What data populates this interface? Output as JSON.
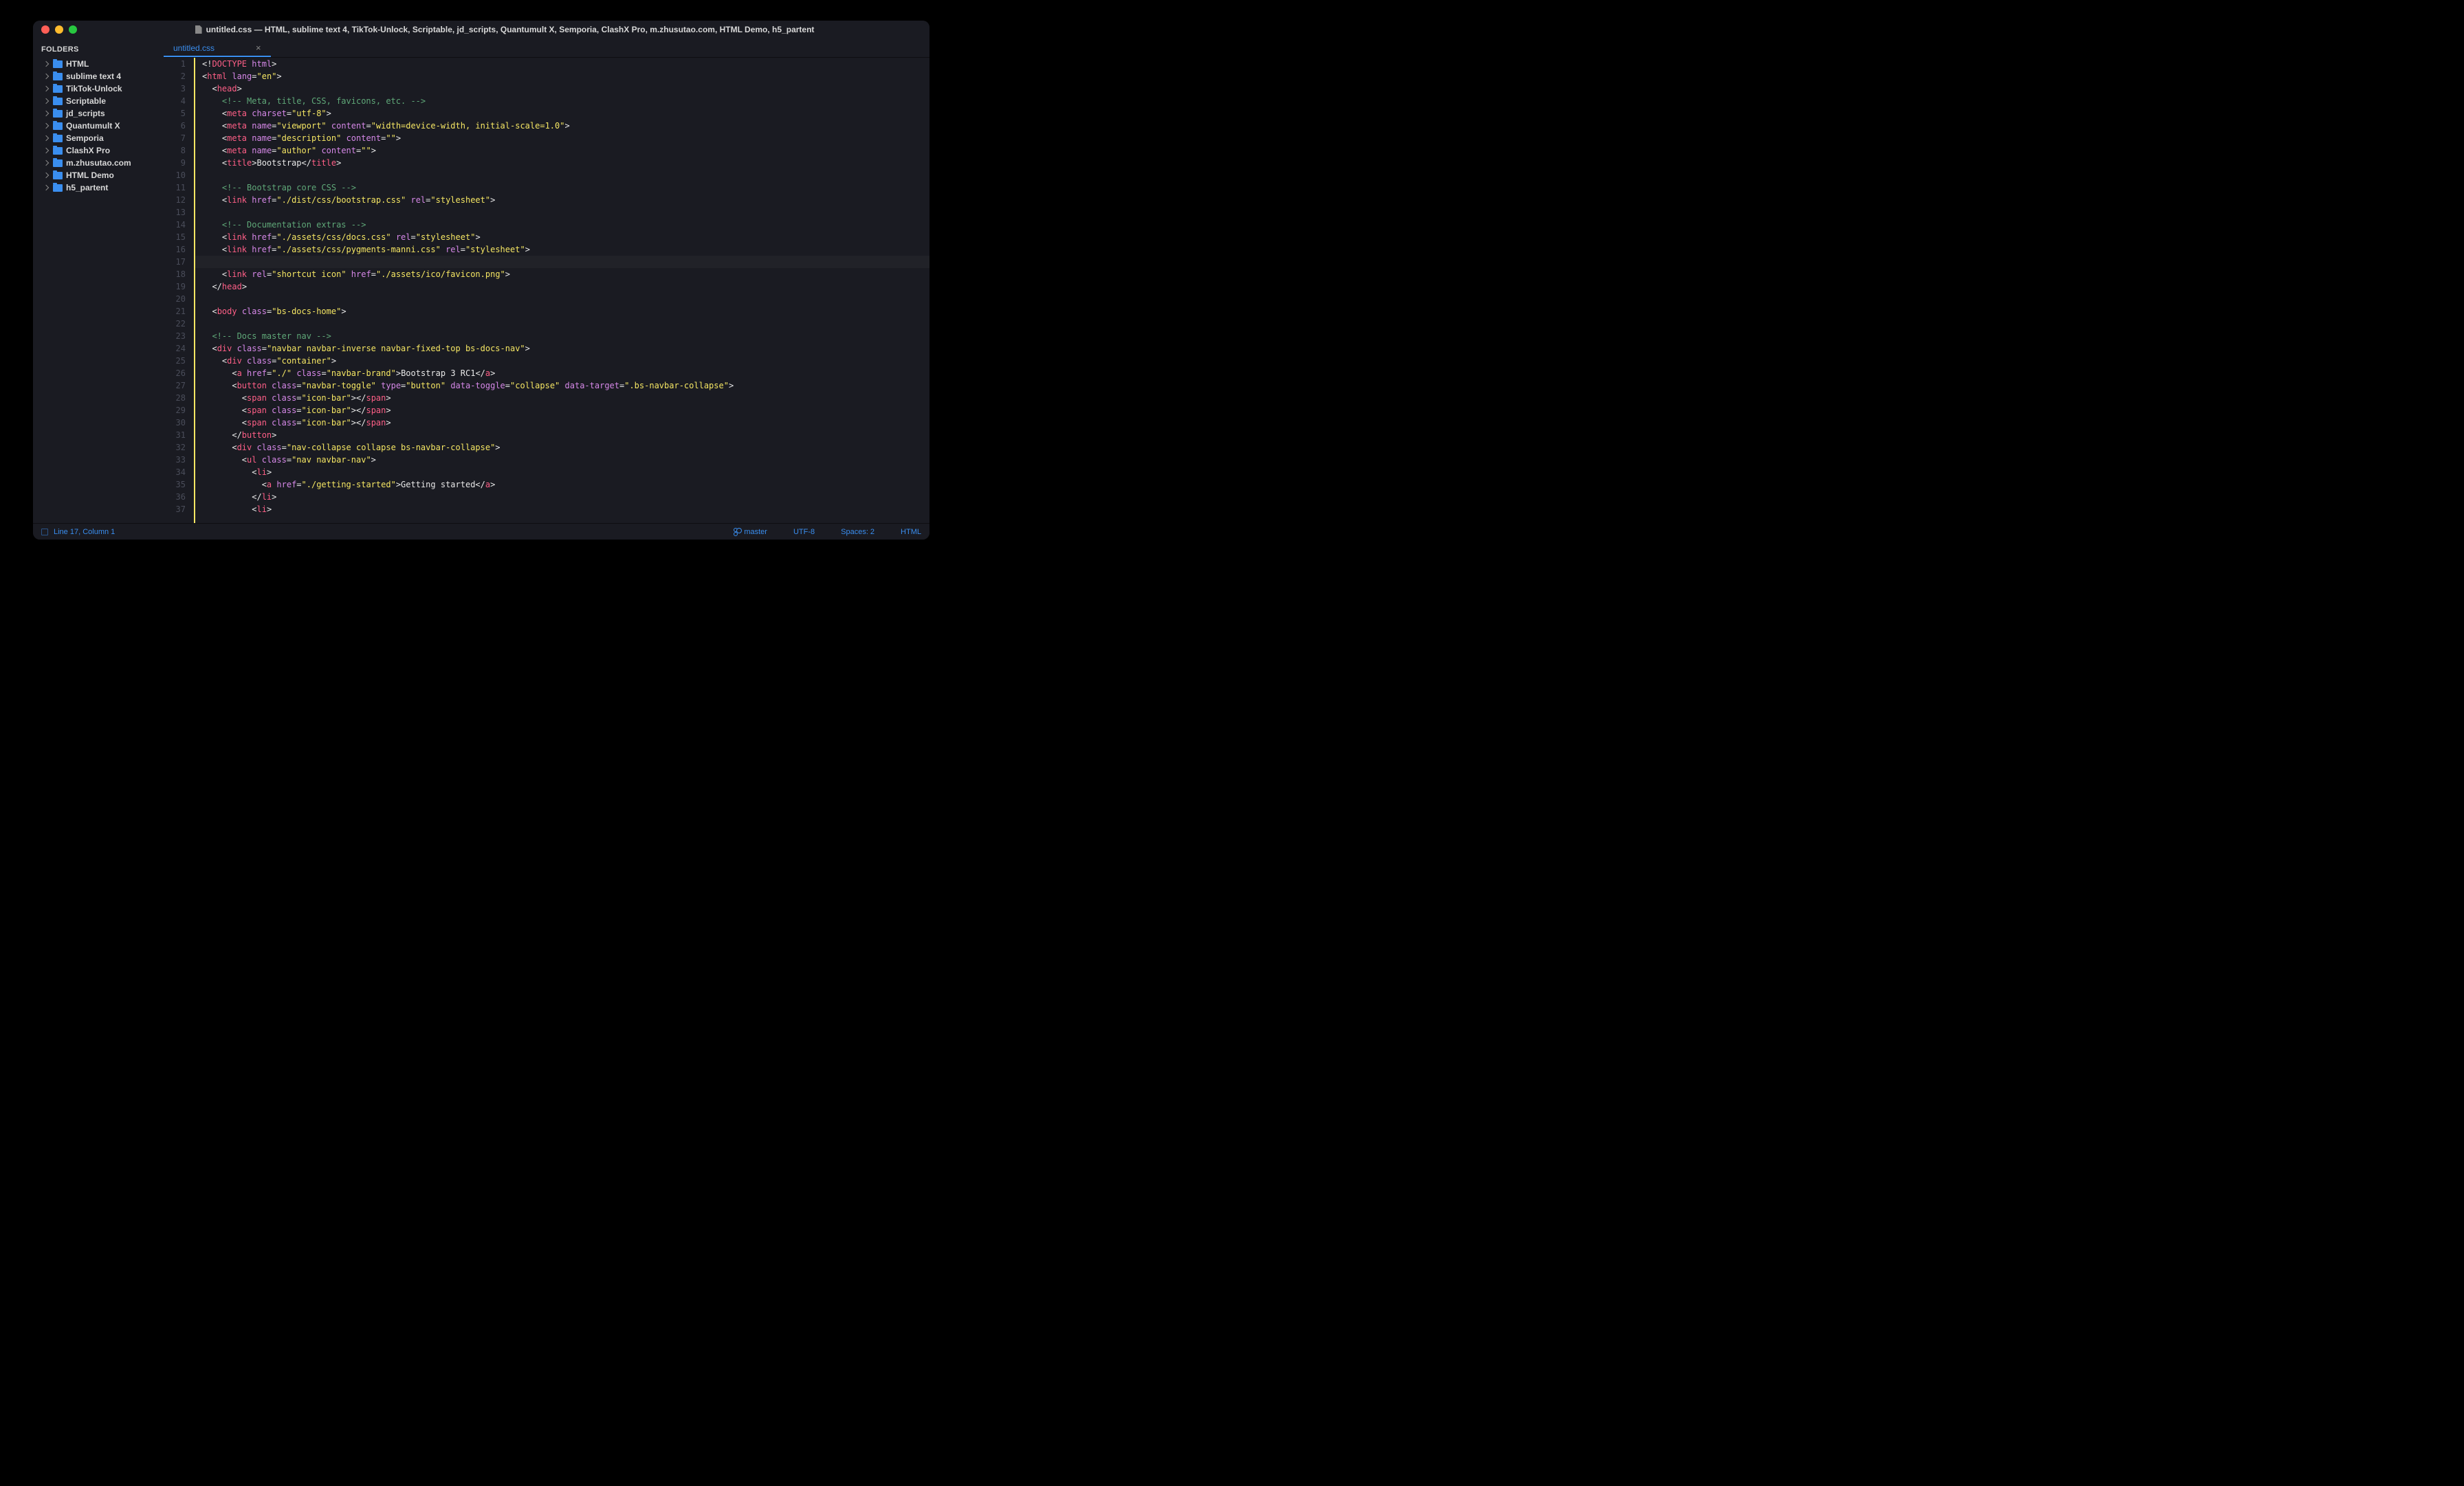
{
  "titlebar": {
    "title": "untitled.css — HTML, sublime text 4, TikTok-Unlock, Scriptable, jd_scripts, Quantumult X, Semporia, ClashX Pro, m.zhusutao.com, HTML Demo, h5_partent"
  },
  "sidebar": {
    "header": "FOLDERS",
    "folders": [
      "HTML",
      "sublime text 4",
      "TikTok-Unlock",
      "Scriptable",
      "jd_scripts",
      "Quantumult X",
      "Semporia",
      "ClashX Pro",
      "m.zhusutao.com",
      "HTML Demo",
      "h5_partent"
    ]
  },
  "tabs": {
    "active": "untitled.css"
  },
  "code": {
    "lines": [
      {
        "n": 1,
        "t": [
          [
            "<!",
            "punc"
          ],
          [
            "DOCTYPE",
            "doctype"
          ],
          [
            " ",
            "punc"
          ],
          [
            "html",
            "doctype-val"
          ],
          [
            ">",
            "punc"
          ]
        ]
      },
      {
        "n": 2,
        "t": [
          [
            "<",
            "punc"
          ],
          [
            "html",
            "tag"
          ],
          [
            " ",
            "punc"
          ],
          [
            "lang",
            "attr"
          ],
          [
            "=",
            "punc"
          ],
          [
            "\"en\"",
            "string"
          ],
          [
            ">",
            "punc"
          ]
        ]
      },
      {
        "n": 3,
        "t": [
          [
            "  <",
            "punc"
          ],
          [
            "head",
            "tag"
          ],
          [
            ">",
            "punc"
          ]
        ]
      },
      {
        "n": 4,
        "t": [
          [
            "    ",
            "punc"
          ],
          [
            "<!-- Meta, title, CSS, favicons, etc. -->",
            "comment"
          ]
        ]
      },
      {
        "n": 5,
        "t": [
          [
            "    <",
            "punc"
          ],
          [
            "meta",
            "tag"
          ],
          [
            " ",
            "punc"
          ],
          [
            "charset",
            "attr"
          ],
          [
            "=",
            "punc"
          ],
          [
            "\"utf-8\"",
            "string"
          ],
          [
            ">",
            "punc"
          ]
        ]
      },
      {
        "n": 6,
        "t": [
          [
            "    <",
            "punc"
          ],
          [
            "meta",
            "tag"
          ],
          [
            " ",
            "punc"
          ],
          [
            "name",
            "attr"
          ],
          [
            "=",
            "punc"
          ],
          [
            "\"viewport\"",
            "string"
          ],
          [
            " ",
            "punc"
          ],
          [
            "content",
            "attr"
          ],
          [
            "=",
            "punc"
          ],
          [
            "\"width=device-width, initial-scale=1.0\"",
            "string"
          ],
          [
            ">",
            "punc"
          ]
        ]
      },
      {
        "n": 7,
        "t": [
          [
            "    <",
            "punc"
          ],
          [
            "meta",
            "tag"
          ],
          [
            " ",
            "punc"
          ],
          [
            "name",
            "attr"
          ],
          [
            "=",
            "punc"
          ],
          [
            "\"description\"",
            "string"
          ],
          [
            " ",
            "punc"
          ],
          [
            "content",
            "attr"
          ],
          [
            "=",
            "punc"
          ],
          [
            "\"\"",
            "string"
          ],
          [
            ">",
            "punc"
          ]
        ]
      },
      {
        "n": 8,
        "t": [
          [
            "    <",
            "punc"
          ],
          [
            "meta",
            "tag"
          ],
          [
            " ",
            "punc"
          ],
          [
            "name",
            "attr"
          ],
          [
            "=",
            "punc"
          ],
          [
            "\"author\"",
            "string"
          ],
          [
            " ",
            "punc"
          ],
          [
            "content",
            "attr"
          ],
          [
            "=",
            "punc"
          ],
          [
            "\"\"",
            "string"
          ],
          [
            ">",
            "punc"
          ]
        ]
      },
      {
        "n": 9,
        "t": [
          [
            "    <",
            "punc"
          ],
          [
            "title",
            "tag"
          ],
          [
            ">",
            "punc"
          ],
          [
            "Bootstrap",
            "text"
          ],
          [
            "</",
            "punc"
          ],
          [
            "title",
            "tag"
          ],
          [
            ">",
            "punc"
          ]
        ]
      },
      {
        "n": 10,
        "t": []
      },
      {
        "n": 11,
        "t": [
          [
            "    ",
            "punc"
          ],
          [
            "<!-- Bootstrap core CSS -->",
            "comment"
          ]
        ]
      },
      {
        "n": 12,
        "t": [
          [
            "    <",
            "punc"
          ],
          [
            "link",
            "tag"
          ],
          [
            " ",
            "punc"
          ],
          [
            "href",
            "attr"
          ],
          [
            "=",
            "punc"
          ],
          [
            "\"./dist/css/bootstrap.css\"",
            "string"
          ],
          [
            " ",
            "punc"
          ],
          [
            "rel",
            "attr"
          ],
          [
            "=",
            "punc"
          ],
          [
            "\"stylesheet\"",
            "string"
          ],
          [
            ">",
            "punc"
          ]
        ]
      },
      {
        "n": 13,
        "t": []
      },
      {
        "n": 14,
        "t": [
          [
            "    ",
            "punc"
          ],
          [
            "<!-- Documentation extras -->",
            "comment"
          ]
        ]
      },
      {
        "n": 15,
        "t": [
          [
            "    <",
            "punc"
          ],
          [
            "link",
            "tag"
          ],
          [
            " ",
            "punc"
          ],
          [
            "href",
            "attr"
          ],
          [
            "=",
            "punc"
          ],
          [
            "\"./assets/css/docs.css\"",
            "string"
          ],
          [
            " ",
            "punc"
          ],
          [
            "rel",
            "attr"
          ],
          [
            "=",
            "punc"
          ],
          [
            "\"stylesheet\"",
            "string"
          ],
          [
            ">",
            "punc"
          ]
        ]
      },
      {
        "n": 16,
        "t": [
          [
            "    <",
            "punc"
          ],
          [
            "link",
            "tag"
          ],
          [
            " ",
            "punc"
          ],
          [
            "href",
            "attr"
          ],
          [
            "=",
            "punc"
          ],
          [
            "\"./assets/css/pygments-manni.css\"",
            "string"
          ],
          [
            " ",
            "punc"
          ],
          [
            "rel",
            "attr"
          ],
          [
            "=",
            "punc"
          ],
          [
            "\"stylesheet\"",
            "string"
          ],
          [
            ">",
            "punc"
          ]
        ]
      },
      {
        "n": 17,
        "t": [],
        "hl": true
      },
      {
        "n": 18,
        "t": [
          [
            "    <",
            "punc"
          ],
          [
            "link",
            "tag"
          ],
          [
            " ",
            "punc"
          ],
          [
            "rel",
            "attr"
          ],
          [
            "=",
            "punc"
          ],
          [
            "\"shortcut icon\"",
            "string"
          ],
          [
            " ",
            "punc"
          ],
          [
            "href",
            "attr"
          ],
          [
            "=",
            "punc"
          ],
          [
            "\"./assets/ico/favicon.png\"",
            "string"
          ],
          [
            ">",
            "punc"
          ]
        ]
      },
      {
        "n": 19,
        "t": [
          [
            "  </",
            "punc"
          ],
          [
            "head",
            "tag"
          ],
          [
            ">",
            "punc"
          ]
        ]
      },
      {
        "n": 20,
        "t": []
      },
      {
        "n": 21,
        "t": [
          [
            "  <",
            "punc"
          ],
          [
            "body",
            "tag"
          ],
          [
            " ",
            "punc"
          ],
          [
            "class",
            "attr"
          ],
          [
            "=",
            "punc"
          ],
          [
            "\"bs-docs-home\"",
            "string"
          ],
          [
            ">",
            "punc"
          ]
        ]
      },
      {
        "n": 22,
        "t": []
      },
      {
        "n": 23,
        "t": [
          [
            "  ",
            "punc"
          ],
          [
            "<!-- Docs master nav -->",
            "comment"
          ]
        ]
      },
      {
        "n": 24,
        "t": [
          [
            "  <",
            "punc"
          ],
          [
            "div",
            "tag"
          ],
          [
            " ",
            "punc"
          ],
          [
            "class",
            "attr"
          ],
          [
            "=",
            "punc"
          ],
          [
            "\"navbar navbar-inverse navbar-fixed-top bs-docs-nav\"",
            "string"
          ],
          [
            ">",
            "punc"
          ]
        ]
      },
      {
        "n": 25,
        "t": [
          [
            "    <",
            "punc"
          ],
          [
            "div",
            "tag"
          ],
          [
            " ",
            "punc"
          ],
          [
            "class",
            "attr"
          ],
          [
            "=",
            "punc"
          ],
          [
            "\"container\"",
            "string"
          ],
          [
            ">",
            "punc"
          ]
        ]
      },
      {
        "n": 26,
        "t": [
          [
            "      <",
            "punc"
          ],
          [
            "a",
            "tag"
          ],
          [
            " ",
            "punc"
          ],
          [
            "href",
            "attr"
          ],
          [
            "=",
            "punc"
          ],
          [
            "\"./\"",
            "string"
          ],
          [
            " ",
            "punc"
          ],
          [
            "class",
            "attr"
          ],
          [
            "=",
            "punc"
          ],
          [
            "\"navbar-brand\"",
            "string"
          ],
          [
            ">",
            "punc"
          ],
          [
            "Bootstrap 3 RC1",
            "text"
          ],
          [
            "</",
            "punc"
          ],
          [
            "a",
            "tag"
          ],
          [
            ">",
            "punc"
          ]
        ]
      },
      {
        "n": 27,
        "t": [
          [
            "      <",
            "punc"
          ],
          [
            "button",
            "tag"
          ],
          [
            " ",
            "punc"
          ],
          [
            "class",
            "attr"
          ],
          [
            "=",
            "punc"
          ],
          [
            "\"navbar-toggle\"",
            "string"
          ],
          [
            " ",
            "punc"
          ],
          [
            "type",
            "attr"
          ],
          [
            "=",
            "punc"
          ],
          [
            "\"button\"",
            "string"
          ],
          [
            " ",
            "punc"
          ],
          [
            "data-toggle",
            "attr"
          ],
          [
            "=",
            "punc"
          ],
          [
            "\"collapse\"",
            "string"
          ],
          [
            " ",
            "punc"
          ],
          [
            "data-target",
            "attr"
          ],
          [
            "=",
            "punc"
          ],
          [
            "\".bs-navbar-collapse\"",
            "string"
          ],
          [
            ">",
            "punc"
          ]
        ]
      },
      {
        "n": 28,
        "t": [
          [
            "        <",
            "punc"
          ],
          [
            "span",
            "tag"
          ],
          [
            " ",
            "punc"
          ],
          [
            "class",
            "attr"
          ],
          [
            "=",
            "punc"
          ],
          [
            "\"icon-bar\"",
            "string"
          ],
          [
            "></",
            "punc"
          ],
          [
            "span",
            "tag"
          ],
          [
            ">",
            "punc"
          ]
        ]
      },
      {
        "n": 29,
        "t": [
          [
            "        <",
            "punc"
          ],
          [
            "span",
            "tag"
          ],
          [
            " ",
            "punc"
          ],
          [
            "class",
            "attr"
          ],
          [
            "=",
            "punc"
          ],
          [
            "\"icon-bar\"",
            "string"
          ],
          [
            "></",
            "punc"
          ],
          [
            "span",
            "tag"
          ],
          [
            ">",
            "punc"
          ]
        ]
      },
      {
        "n": 30,
        "t": [
          [
            "        <",
            "punc"
          ],
          [
            "span",
            "tag"
          ],
          [
            " ",
            "punc"
          ],
          [
            "class",
            "attr"
          ],
          [
            "=",
            "punc"
          ],
          [
            "\"icon-bar\"",
            "string"
          ],
          [
            "></",
            "punc"
          ],
          [
            "span",
            "tag"
          ],
          [
            ">",
            "punc"
          ]
        ]
      },
      {
        "n": 31,
        "t": [
          [
            "      </",
            "punc"
          ],
          [
            "button",
            "tag"
          ],
          [
            ">",
            "punc"
          ]
        ]
      },
      {
        "n": 32,
        "t": [
          [
            "      <",
            "punc"
          ],
          [
            "div",
            "tag"
          ],
          [
            " ",
            "punc"
          ],
          [
            "class",
            "attr"
          ],
          [
            "=",
            "punc"
          ],
          [
            "\"nav-collapse collapse bs-navbar-collapse\"",
            "string"
          ],
          [
            ">",
            "punc"
          ]
        ]
      },
      {
        "n": 33,
        "t": [
          [
            "        <",
            "punc"
          ],
          [
            "ul",
            "tag"
          ],
          [
            " ",
            "punc"
          ],
          [
            "class",
            "attr"
          ],
          [
            "=",
            "punc"
          ],
          [
            "\"nav navbar-nav\"",
            "string"
          ],
          [
            ">",
            "punc"
          ]
        ]
      },
      {
        "n": 34,
        "t": [
          [
            "          <",
            "punc"
          ],
          [
            "li",
            "tag"
          ],
          [
            ">",
            "punc"
          ]
        ]
      },
      {
        "n": 35,
        "t": [
          [
            "            <",
            "punc"
          ],
          [
            "a",
            "tag"
          ],
          [
            " ",
            "punc"
          ],
          [
            "href",
            "attr"
          ],
          [
            "=",
            "punc"
          ],
          [
            "\"./getting-started\"",
            "string"
          ],
          [
            ">",
            "punc"
          ],
          [
            "Getting started",
            "text"
          ],
          [
            "</",
            "punc"
          ],
          [
            "a",
            "tag"
          ],
          [
            ">",
            "punc"
          ]
        ]
      },
      {
        "n": 36,
        "t": [
          [
            "          </",
            "punc"
          ],
          [
            "li",
            "tag"
          ],
          [
            ">",
            "punc"
          ]
        ]
      },
      {
        "n": 37,
        "t": [
          [
            "          <",
            "punc"
          ],
          [
            "li",
            "tag"
          ],
          [
            ">",
            "punc"
          ]
        ]
      }
    ]
  },
  "statusbar": {
    "position": "Line 17, Column 1",
    "branch": "master",
    "encoding": "UTF-8",
    "indent": "Spaces: 2",
    "syntax": "HTML"
  }
}
